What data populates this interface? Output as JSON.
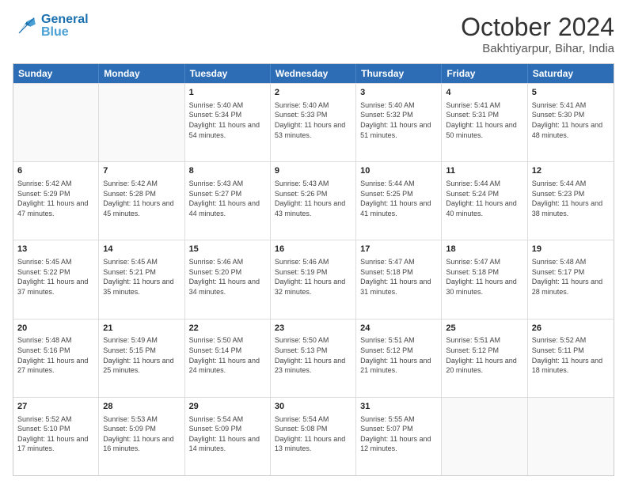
{
  "header": {
    "logo_line1": "General",
    "logo_line2": "Blue",
    "main_title": "October 2024",
    "subtitle": "Bakhtiyarpur, Bihar, India"
  },
  "weekdays": [
    "Sunday",
    "Monday",
    "Tuesday",
    "Wednesday",
    "Thursday",
    "Friday",
    "Saturday"
  ],
  "weeks": [
    [
      {
        "day": "",
        "sunrise": "",
        "sunset": "",
        "daylight": ""
      },
      {
        "day": "",
        "sunrise": "",
        "sunset": "",
        "daylight": ""
      },
      {
        "day": "1",
        "sunrise": "Sunrise: 5:40 AM",
        "sunset": "Sunset: 5:34 PM",
        "daylight": "Daylight: 11 hours and 54 minutes."
      },
      {
        "day": "2",
        "sunrise": "Sunrise: 5:40 AM",
        "sunset": "Sunset: 5:33 PM",
        "daylight": "Daylight: 11 hours and 53 minutes."
      },
      {
        "day": "3",
        "sunrise": "Sunrise: 5:40 AM",
        "sunset": "Sunset: 5:32 PM",
        "daylight": "Daylight: 11 hours and 51 minutes."
      },
      {
        "day": "4",
        "sunrise": "Sunrise: 5:41 AM",
        "sunset": "Sunset: 5:31 PM",
        "daylight": "Daylight: 11 hours and 50 minutes."
      },
      {
        "day": "5",
        "sunrise": "Sunrise: 5:41 AM",
        "sunset": "Sunset: 5:30 PM",
        "daylight": "Daylight: 11 hours and 48 minutes."
      }
    ],
    [
      {
        "day": "6",
        "sunrise": "Sunrise: 5:42 AM",
        "sunset": "Sunset: 5:29 PM",
        "daylight": "Daylight: 11 hours and 47 minutes."
      },
      {
        "day": "7",
        "sunrise": "Sunrise: 5:42 AM",
        "sunset": "Sunset: 5:28 PM",
        "daylight": "Daylight: 11 hours and 45 minutes."
      },
      {
        "day": "8",
        "sunrise": "Sunrise: 5:43 AM",
        "sunset": "Sunset: 5:27 PM",
        "daylight": "Daylight: 11 hours and 44 minutes."
      },
      {
        "day": "9",
        "sunrise": "Sunrise: 5:43 AM",
        "sunset": "Sunset: 5:26 PM",
        "daylight": "Daylight: 11 hours and 43 minutes."
      },
      {
        "day": "10",
        "sunrise": "Sunrise: 5:44 AM",
        "sunset": "Sunset: 5:25 PM",
        "daylight": "Daylight: 11 hours and 41 minutes."
      },
      {
        "day": "11",
        "sunrise": "Sunrise: 5:44 AM",
        "sunset": "Sunset: 5:24 PM",
        "daylight": "Daylight: 11 hours and 40 minutes."
      },
      {
        "day": "12",
        "sunrise": "Sunrise: 5:44 AM",
        "sunset": "Sunset: 5:23 PM",
        "daylight": "Daylight: 11 hours and 38 minutes."
      }
    ],
    [
      {
        "day": "13",
        "sunrise": "Sunrise: 5:45 AM",
        "sunset": "Sunset: 5:22 PM",
        "daylight": "Daylight: 11 hours and 37 minutes."
      },
      {
        "day": "14",
        "sunrise": "Sunrise: 5:45 AM",
        "sunset": "Sunset: 5:21 PM",
        "daylight": "Daylight: 11 hours and 35 minutes."
      },
      {
        "day": "15",
        "sunrise": "Sunrise: 5:46 AM",
        "sunset": "Sunset: 5:20 PM",
        "daylight": "Daylight: 11 hours and 34 minutes."
      },
      {
        "day": "16",
        "sunrise": "Sunrise: 5:46 AM",
        "sunset": "Sunset: 5:19 PM",
        "daylight": "Daylight: 11 hours and 32 minutes."
      },
      {
        "day": "17",
        "sunrise": "Sunrise: 5:47 AM",
        "sunset": "Sunset: 5:18 PM",
        "daylight": "Daylight: 11 hours and 31 minutes."
      },
      {
        "day": "18",
        "sunrise": "Sunrise: 5:47 AM",
        "sunset": "Sunset: 5:18 PM",
        "daylight": "Daylight: 11 hours and 30 minutes."
      },
      {
        "day": "19",
        "sunrise": "Sunrise: 5:48 AM",
        "sunset": "Sunset: 5:17 PM",
        "daylight": "Daylight: 11 hours and 28 minutes."
      }
    ],
    [
      {
        "day": "20",
        "sunrise": "Sunrise: 5:48 AM",
        "sunset": "Sunset: 5:16 PM",
        "daylight": "Daylight: 11 hours and 27 minutes."
      },
      {
        "day": "21",
        "sunrise": "Sunrise: 5:49 AM",
        "sunset": "Sunset: 5:15 PM",
        "daylight": "Daylight: 11 hours and 25 minutes."
      },
      {
        "day": "22",
        "sunrise": "Sunrise: 5:50 AM",
        "sunset": "Sunset: 5:14 PM",
        "daylight": "Daylight: 11 hours and 24 minutes."
      },
      {
        "day": "23",
        "sunrise": "Sunrise: 5:50 AM",
        "sunset": "Sunset: 5:13 PM",
        "daylight": "Daylight: 11 hours and 23 minutes."
      },
      {
        "day": "24",
        "sunrise": "Sunrise: 5:51 AM",
        "sunset": "Sunset: 5:12 PM",
        "daylight": "Daylight: 11 hours and 21 minutes."
      },
      {
        "day": "25",
        "sunrise": "Sunrise: 5:51 AM",
        "sunset": "Sunset: 5:12 PM",
        "daylight": "Daylight: 11 hours and 20 minutes."
      },
      {
        "day": "26",
        "sunrise": "Sunrise: 5:52 AM",
        "sunset": "Sunset: 5:11 PM",
        "daylight": "Daylight: 11 hours and 18 minutes."
      }
    ],
    [
      {
        "day": "27",
        "sunrise": "Sunrise: 5:52 AM",
        "sunset": "Sunset: 5:10 PM",
        "daylight": "Daylight: 11 hours and 17 minutes."
      },
      {
        "day": "28",
        "sunrise": "Sunrise: 5:53 AM",
        "sunset": "Sunset: 5:09 PM",
        "daylight": "Daylight: 11 hours and 16 minutes."
      },
      {
        "day": "29",
        "sunrise": "Sunrise: 5:54 AM",
        "sunset": "Sunset: 5:09 PM",
        "daylight": "Daylight: 11 hours and 14 minutes."
      },
      {
        "day": "30",
        "sunrise": "Sunrise: 5:54 AM",
        "sunset": "Sunset: 5:08 PM",
        "daylight": "Daylight: 11 hours and 13 minutes."
      },
      {
        "day": "31",
        "sunrise": "Sunrise: 5:55 AM",
        "sunset": "Sunset: 5:07 PM",
        "daylight": "Daylight: 11 hours and 12 minutes."
      },
      {
        "day": "",
        "sunrise": "",
        "sunset": "",
        "daylight": ""
      },
      {
        "day": "",
        "sunrise": "",
        "sunset": "",
        "daylight": ""
      }
    ]
  ]
}
